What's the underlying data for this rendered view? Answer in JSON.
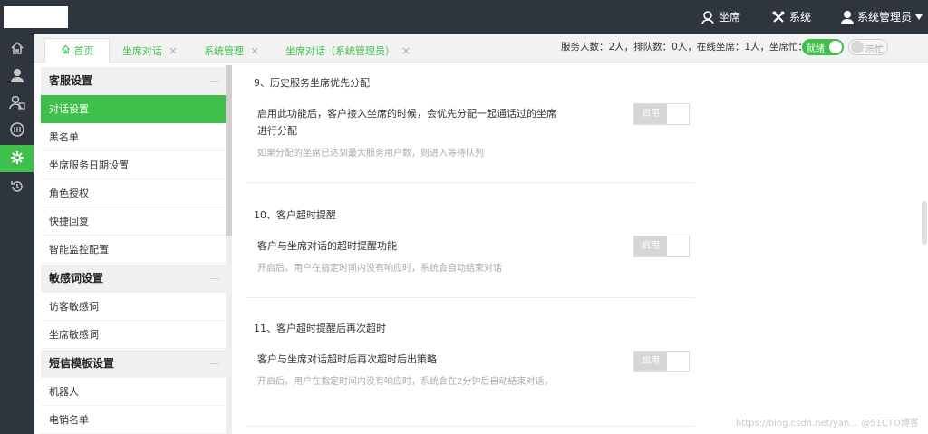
{
  "topbar": {
    "agent_label": "坐席",
    "system_label": "系统",
    "user_label": "系统管理员"
  },
  "iconbar": {
    "items": [
      "home-icon",
      "user-icon",
      "users-icon",
      "knowledge-icon",
      "gear-icon",
      "history-icon"
    ],
    "active_index": 4
  },
  "tabs": [
    {
      "label": "首页",
      "closable": false,
      "icon": "home-icon"
    },
    {
      "label": "坐席对话",
      "closable": true
    },
    {
      "label": "系统管理",
      "closable": true
    },
    {
      "label": "坐席对话（系统管理员）",
      "closable": true
    }
  ],
  "status": {
    "text": "服务人数：2人，排队数：0人，在线坐席：1人，坐席忙：0人",
    "ready_label": "就绪",
    "busy_label": "示忙"
  },
  "menu": {
    "groups": [
      {
        "title": "客服设置",
        "items": [
          "对话设置",
          "黑名单",
          "坐席服务日期设置",
          "角色授权",
          "快捷回复",
          "智能监控配置"
        ]
      },
      {
        "title": "敏感词设置",
        "items": [
          "访客敏感词",
          "坐席敏感词"
        ]
      },
      {
        "title": "短信模板设置",
        "items": [
          "机器人",
          "电销名单"
        ]
      }
    ],
    "active_item": "对话设置"
  },
  "settings": [
    {
      "title": "9、历史服务坐席优先分配",
      "desc": "启用此功能后，客户接入坐席的时候，会优先分配一起通话过的坐席进行分配",
      "hint": "如果分配的坐席已达到最大服务用户数，则进入等待队列",
      "switch_label": "启用"
    },
    {
      "title": "10、客户超时提醒",
      "desc": "客户与坐席对话的超时提醒功能",
      "hint": "开启后，用户在指定时间内没有响应时，系统会自动结束对话",
      "switch_label": "启用"
    },
    {
      "title": "11、客户超时提醒后再次超时",
      "desc": "客户与坐席对话超时后再次超时后出策略",
      "hint": "开启后，用户在指定时间内没有响应时，系统会在2分钟后自动结束对话，",
      "switch_label": "启用"
    }
  ],
  "watermark": "https://blog.csdn.net/yan... @51CTO博客"
}
